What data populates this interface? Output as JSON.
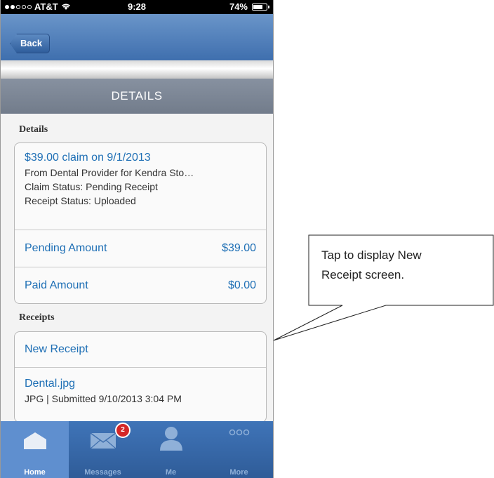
{
  "status_bar": {
    "carrier": "AT&T",
    "time": "9:28",
    "battery": "74%",
    "battery_level": 0.74
  },
  "nav": {
    "back_label": "Back"
  },
  "header": {
    "title": "DETAILS"
  },
  "details": {
    "section_label": "Details",
    "claim": {
      "title": "$39.00 claim on 9/1/2013",
      "provider": "From Dental Provider for Kendra Sto…",
      "claim_status": "Claim Status: Pending Receipt",
      "receipt_status": "Receipt Status: Uploaded"
    },
    "pending": {
      "label": "Pending Amount",
      "value": "$39.00"
    },
    "paid": {
      "label": "Paid Amount",
      "value": "$0.00"
    }
  },
  "receipts": {
    "section_label": "Receipts",
    "new_receipt_label": "New Receipt",
    "items": [
      {
        "name": "Dental.jpg",
        "meta": "JPG | Submitted 9/10/2013 3:04 PM"
      }
    ]
  },
  "tabs": [
    {
      "label": "Home",
      "icon": "home-icon",
      "active": true
    },
    {
      "label": "Messages",
      "icon": "envelope-icon",
      "badge": "2"
    },
    {
      "label": "Me",
      "icon": "person-icon"
    },
    {
      "label": "More",
      "icon": "more-dots-icon"
    }
  ],
  "callout": {
    "line1": "Tap to display New",
    "line2": "Receipt screen."
  }
}
